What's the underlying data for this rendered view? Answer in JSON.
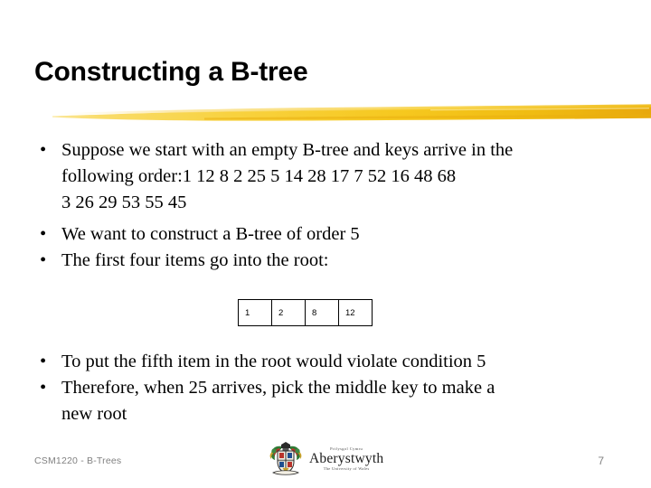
{
  "slide": {
    "title": "Constructing a B-tree",
    "accent_color": "#F2C40C",
    "background_color": "#FFFFFF",
    "text_color": "#000000"
  },
  "bullets_group_one": [
    {
      "marker": "•",
      "lines": [
        "Suppose we start with an empty B-tree and keys arrive in the",
        "following order:1  12  8  2  25  5  14  28  17  7  52  16  48  68",
        "3  26  29  53  55  45"
      ]
    }
  ],
  "bullets_group_two": [
    {
      "marker": "•",
      "lines": [
        "We want to construct a B-tree of order 5"
      ]
    },
    {
      "marker": "•",
      "lines": [
        "The first four items go into the root:"
      ]
    }
  ],
  "bullets_group_three": [
    {
      "marker": "•",
      "lines": [
        "To put the fifth item in the root would violate condition 5"
      ]
    },
    {
      "marker": "•",
      "lines": [
        "Therefore, when 25 arrives, pick the middle key to make a",
        "new root"
      ]
    }
  ],
  "btree_node": {
    "keys": [
      "1",
      "2",
      "8",
      "12"
    ]
  },
  "footer": {
    "course": "CSM1220 - B-Trees",
    "page_number": "7",
    "color": "#808080"
  },
  "logo": {
    "top_line": "Prifysgol Cymru",
    "name": "Aberystwyth",
    "bottom_line": "The University of Wales"
  }
}
